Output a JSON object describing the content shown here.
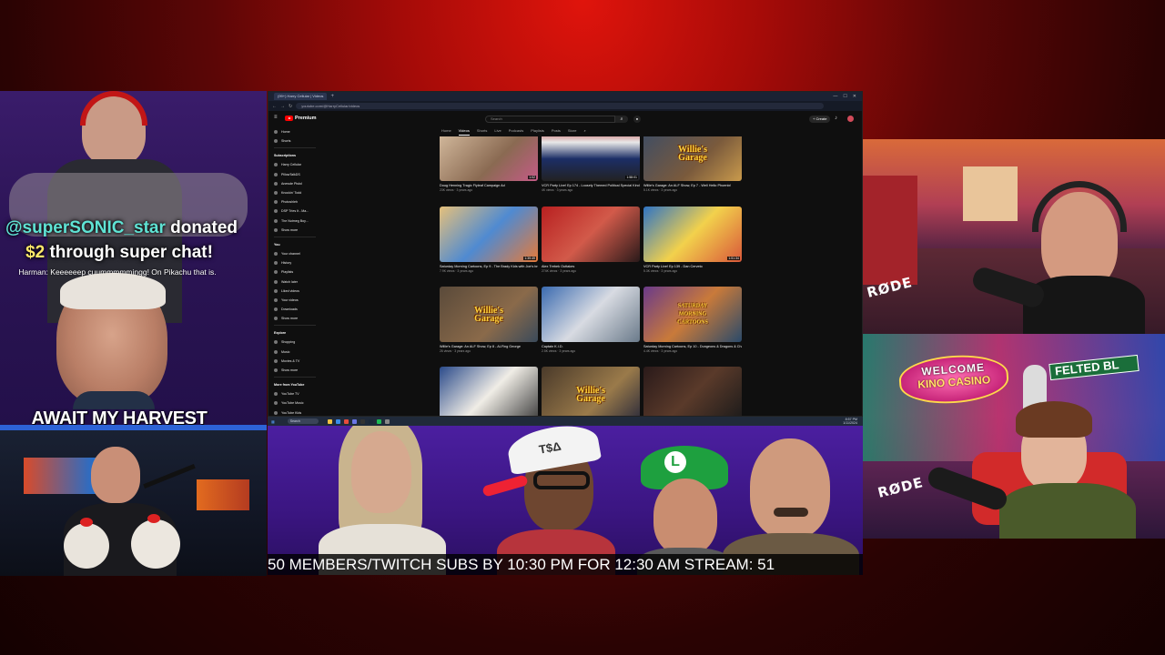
{
  "donation": {
    "username": "@superSONIC_star",
    "donated_word": " donated",
    "amount": "$2",
    "through": " through super chat!",
    "message": "Harman: Keeeeeep cuummmmmingg! On Pikachu that is."
  },
  "left_caption": "AWAIT MY HARVEST",
  "ticker_text": "50 MEMBERS/TWITCH SUBS BY 10:30 PM FOR 12:30 AM STREAM: 51",
  "browser": {
    "tab_label": "(99+) Harry Cellular | Videos",
    "tab_plus": "+",
    "url": "youtube.com/@HarryCellular/videos",
    "youtube": {
      "logo_text": "Premium",
      "search_placeholder": "Search",
      "create_label": "+ Create",
      "sidebar": {
        "top": [
          "Home",
          "Shorts"
        ],
        "subscriptions_heading": "Subscriptions",
        "subscriptions": [
          "Harry Cellular",
          "PillowTalkDS",
          "Anewde Pistol",
          "Knockin' Todd",
          "Photoshleh",
          "DSP Tries It - Ma...",
          "The Nutmeg Boy..."
        ],
        "show_more": "Show more",
        "you_heading": "You",
        "you_items": [
          "Your channel",
          "History",
          "Playlists",
          "Watch later",
          "Liked videos",
          "Your videos",
          "Downloads",
          "Show more"
        ],
        "explore_heading": "Explore",
        "explore_items": [
          "Shopping",
          "Music",
          "Movies & TV",
          "Show more"
        ],
        "more_heading": "More from YouTube",
        "more_items": [
          "YouTube TV",
          "YouTube Music",
          "YouTube Kids"
        ]
      },
      "channel_tabs": [
        "Home",
        "Videos",
        "Shorts",
        "Live",
        "Podcasts",
        "Playlists",
        "Posts",
        "Store"
      ],
      "active_tab": "Videos",
      "videos": [
        {
          "title": "Doug Henning Tragic Flyleaf Campaign Ad",
          "meta": "23K views · 3 years ago",
          "duration": "1:02",
          "emblem": ""
        },
        {
          "title": "VCR Party Live! Ep 174 - Loosely Themed Political Special Kind Of",
          "meta": "4K views · 3 years ago",
          "duration": "1:58:01",
          "emblem": ""
        },
        {
          "title": "Willie's Garage: An ALF Show, Ep 7 - Well Hello Phoenix!",
          "meta": "5.1K views · 3 years ago",
          "duration": "",
          "emblem": "Willie's Garage"
        },
        {
          "title": "Saturday Morning Cartoons, Ep 9 - The Brady Kids with Joe's brother, Alex Pickett",
          "meta": "7.9K views · 3 years ago",
          "duration": "1:39:49",
          "emblem": ""
        },
        {
          "title": "Alex Trebek Outtakes",
          "meta": "274K views · 3 years ago",
          "duration": "",
          "emblem": ""
        },
        {
          "title": "VCR Party Live! Ep 139 - Dan Cerveto",
          "meta": "5.3K views · 3 years ago",
          "duration": "1:51:34",
          "emblem": ""
        },
        {
          "title": "Willie's Garage: An ALF Show, Ep 8 - ALFing George",
          "meta": "26 views · 3 years ago",
          "duration": "",
          "emblem": "Willie's Garage"
        },
        {
          "title": "Captain K.I.D.",
          "meta": "2.5K views · 3 years ago",
          "duration": "",
          "emblem": ""
        },
        {
          "title": "Saturday Morning Cartoons, Ep 10 - Dungeons & Dragons & Charlie Sanders",
          "meta": "4.4K views · 3 years ago",
          "duration": "",
          "emblem": "SATURDAY MORNING CARTOONS"
        },
        {
          "title": "",
          "meta": "",
          "duration": "",
          "emblem": ""
        },
        {
          "title": "",
          "meta": "",
          "duration": "",
          "emblem": "Willie's Garage"
        },
        {
          "title": "",
          "meta": "",
          "duration": "",
          "emblem": ""
        }
      ]
    }
  },
  "taskbar": {
    "search_placeholder": "Search",
    "time": "8:57 PM",
    "date": "1/11/2024"
  },
  "right_cam_bottom": {
    "welcome": "WELCOME",
    "casino": "KINO CASINO",
    "street_sign": "FELTED BL",
    "mic_brand": "RØDE"
  },
  "right_cam_top": {
    "mic_brand": "RØDE"
  },
  "banner_hat_text": "T$Δ",
  "colors": {
    "background_red": "#a50b08",
    "overlay_purple": "#3a1c6b",
    "banner_purple": "#4b1fa0",
    "donation_name": "#5fe3d4",
    "donation_amount": "#ffe96a"
  }
}
